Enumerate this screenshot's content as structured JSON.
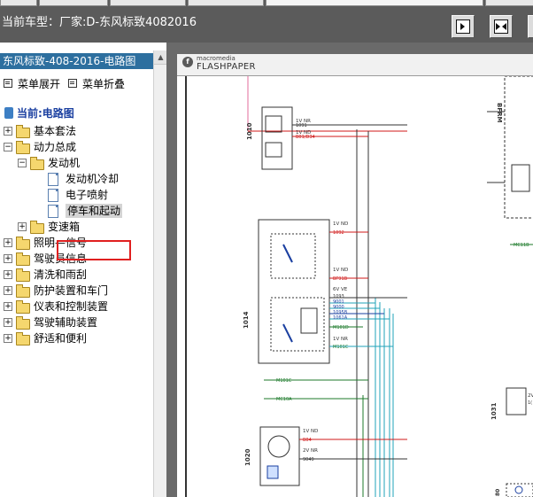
{
  "header": {
    "car_title": "当前车型：厂家:D-东风标致4082016"
  },
  "toolbar": {
    "buttons": [
      {
        "name": "single-page-icon"
      },
      {
        "name": "two-page-icon"
      }
    ]
  },
  "tree": {
    "header": "东风标致-408-2016-电路图",
    "expand_all": "菜单展开",
    "collapse_all": "菜单折叠",
    "root": "当前:电路图",
    "items": [
      {
        "label": "基本套法",
        "level": 1,
        "expander": "+"
      },
      {
        "label": "动力总成",
        "level": 1,
        "expander": "−"
      },
      {
        "label": "发动机",
        "level": 2,
        "expander": "−"
      },
      {
        "label": "发动机冷却",
        "level": 3
      },
      {
        "label": "电子喷射",
        "level": 3
      },
      {
        "label": "停车和起动",
        "level": 3,
        "selected": true
      },
      {
        "label": "变速箱",
        "level": 2,
        "expander": "+"
      },
      {
        "label": "照明—信号",
        "level": 1,
        "expander": "+"
      },
      {
        "label": "驾驶员信息",
        "level": 1,
        "expander": "+"
      },
      {
        "label": "清洗和雨刮",
        "level": 1,
        "expander": "+"
      },
      {
        "label": "防护装置和车门",
        "level": 1,
        "expander": "+"
      },
      {
        "label": "仪表和控制装置",
        "level": 1,
        "expander": "+"
      },
      {
        "label": "驾驶辅助装置",
        "level": 1,
        "expander": "+"
      },
      {
        "label": "舒适和便利",
        "level": 1,
        "expander": "+"
      }
    ]
  },
  "viewer": {
    "brand_small": "macromedia",
    "brand_big": "FLASHPAPER",
    "flash_logo": "f"
  },
  "diagram": {
    "components": [
      {
        "id": "1010"
      },
      {
        "id": "1014"
      },
      {
        "id": "1020"
      },
      {
        "id": "1031"
      },
      {
        "id": "BFRM"
      },
      {
        "id": "80"
      }
    ],
    "labels": [
      {
        "text": "1V NR"
      },
      {
        "text": "1091"
      },
      {
        "text": "1V ND"
      },
      {
        "text": "B01/D34"
      },
      {
        "text": "1V ND"
      },
      {
        "text": "1092"
      },
      {
        "text": "1V ND"
      },
      {
        "text": "BF91B"
      },
      {
        "text": "6V VE"
      },
      {
        "text": "1093"
      },
      {
        "text": "9001"
      },
      {
        "text": "9000"
      },
      {
        "text": "1095B"
      },
      {
        "text": "1061A"
      },
      {
        "text": "M101D"
      },
      {
        "text": "1V NR"
      },
      {
        "text": "M101C"
      },
      {
        "text": "M101C"
      },
      {
        "text": "MC10A"
      },
      {
        "text": "MC11B"
      },
      {
        "text": "1V ND"
      },
      {
        "text": "B04"
      },
      {
        "text": "2V NR"
      },
      {
        "text": "9049"
      },
      {
        "text": "2V"
      },
      {
        "text": "1("
      }
    ],
    "colors": {
      "red": "#d01818",
      "blue": "#1a3fa0",
      "green": "#1c7a2a",
      "teal": "#1fa3b8",
      "pink": "#e36b9b",
      "dark": "#333333"
    }
  }
}
